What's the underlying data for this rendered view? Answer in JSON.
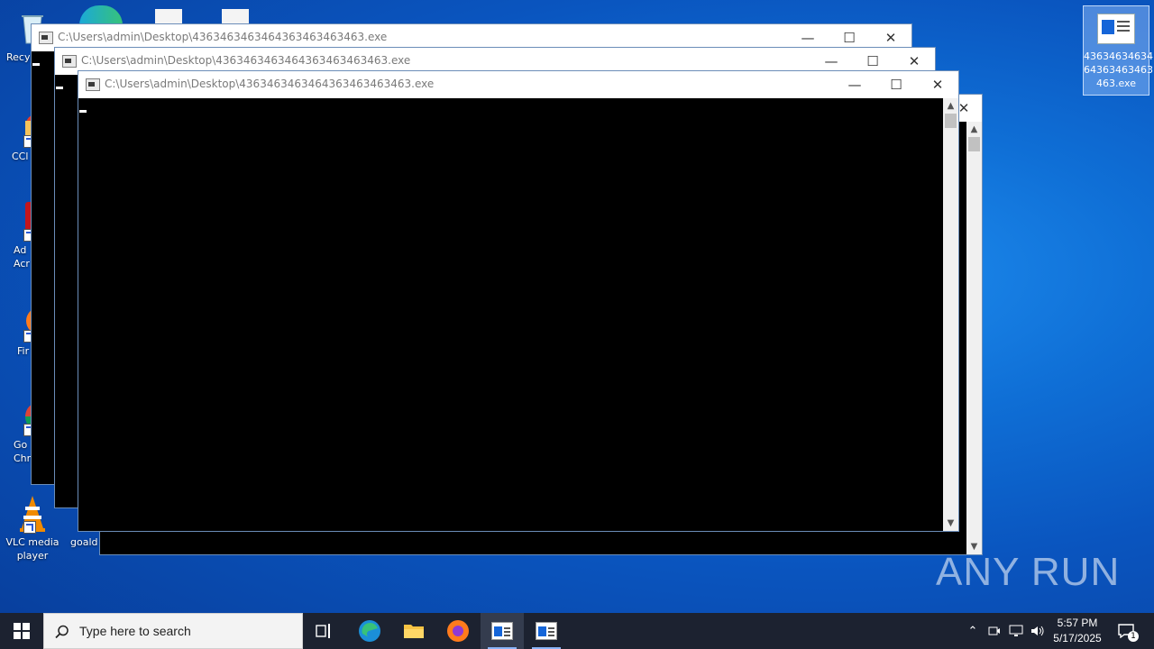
{
  "desktop": {
    "icons": [
      {
        "label": "Recy",
        "icon": "recycle-bin-icon"
      },
      {
        "label": "CCl",
        "icon": "ccleaner-icon"
      },
      {
        "label": "Ad\nAcr",
        "icon": "acrobat-icon"
      },
      {
        "label": "Fir",
        "icon": "firefox-icon"
      },
      {
        "label": "Go\nChr",
        "icon": "chrome-icon"
      },
      {
        "label": "VLC media\nplayer",
        "icon": "vlc-icon"
      },
      {
        "label": "goald",
        "icon": "file-icon"
      }
    ],
    "selected_icon": {
      "label": "43634634634\n64363463463\n463.exe",
      "icon": "exe-icon"
    }
  },
  "windows": [
    {
      "title": "C:\\Users\\admin\\Desktop\\4363463463464363463463463.exe"
    },
    {
      "title": "C:\\Users\\admin\\Desktop\\4363463463464363463463463.exe"
    },
    {
      "title": "C:\\Users\\admin\\Desktop\\4363463463464363463463463.exe"
    }
  ],
  "window_controls": {
    "minimize": "—",
    "maximize": "☐",
    "close": "✕"
  },
  "taskbar": {
    "search_placeholder": "Type here to search",
    "clock_time": "5:57 PM",
    "clock_date": "5/17/2025",
    "notification_count": "1"
  },
  "watermark": "ANY RUN",
  "colors": {
    "console_bg": "#000000",
    "taskbar_bg": "#1c2230",
    "accent": "#8ab4f8"
  }
}
